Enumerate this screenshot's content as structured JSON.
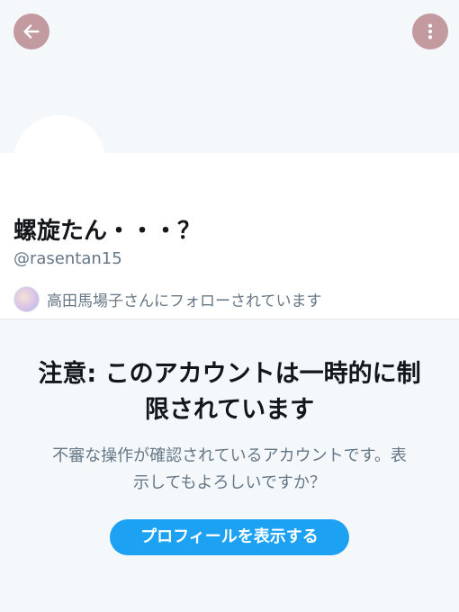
{
  "header": {
    "back_icon": "arrow-left-icon",
    "more_icon": "more-vertical-icon"
  },
  "profile": {
    "display_name": "螺旋たん・・・？",
    "handle": "@rasentan15",
    "followed_by": "高田馬場子さんにフォローされています"
  },
  "warning": {
    "title": "注意: このアカウントは一時的に制限されています",
    "body": "不審な操作が確認されているアカウントです。表示してもよろしいですか？",
    "button_label": "プロフィールを表示する"
  },
  "colors": {
    "accent": "#1da1f2",
    "header_button": "#c39aa0"
  }
}
